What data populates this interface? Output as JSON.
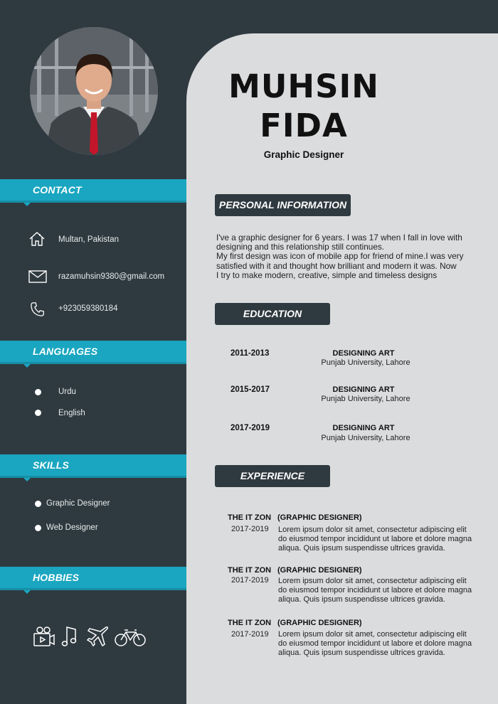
{
  "name": {
    "first": "MUHSIN",
    "last": "FIDA"
  },
  "role": "Graphic Designer",
  "sidebar": {
    "contact": {
      "title": "CONTACT",
      "items": [
        {
          "icon": "home-icon",
          "text": "Multan, Pakistan"
        },
        {
          "icon": "mail-icon",
          "text": "razamuhsin9380@gmail.com"
        },
        {
          "icon": "phone-icon",
          "text": "+923059380184"
        }
      ]
    },
    "languages": {
      "title": "LANGUAGES",
      "items": [
        "Urdu",
        "English"
      ]
    },
    "skills": {
      "title": "SKILLS",
      "items": [
        "Graphic Designer",
        "Web Designer"
      ]
    },
    "hobbies": {
      "title": "HOBBIES",
      "icons": [
        "video-camera-icon",
        "music-note-icon",
        "airplane-icon",
        "bicycle-icon"
      ]
    }
  },
  "personal_info": {
    "title": "PERSONAL INFORMATION",
    "lines": [
      "I've a graphic designer for 6 years. I was 17 when I fall in love with",
      "designing and this relationship still continues.",
      "My first design was icon of mobile app for friend of mine.I was very",
      "satisfied with it and thought how brilliant and modern it was. Now",
      "I try to make modern, creative, simple and timeless designs"
    ]
  },
  "education": {
    "title": "EDUCATION",
    "entries": [
      {
        "years": "2011-2013",
        "title": "DESIGNING ART",
        "place": "Punjab University, Lahore"
      },
      {
        "years": "2015-2017",
        "title": "DESIGNING ART",
        "place": "Punjab University, Lahore"
      },
      {
        "years": "2017-2019",
        "title": "DESIGNING ART",
        "place": "Punjab University, Lahore"
      }
    ]
  },
  "experience": {
    "title": "EXPERIENCE",
    "entries": [
      {
        "company": "THE IT ZON",
        "role": "(GRAPHIC DESIGNER)",
        "years": "2017-2019",
        "lines": [
          "Lorem ipsum dolor sit amet, consectetur adipiscing elit",
          "do eiusmod tempor incididunt ut labore et dolore magna",
          "aliqua. Quis ipsum suspendisse ultrices gravida."
        ]
      },
      {
        "company": "THE IT ZON",
        "role": "(GRAPHIC DESIGNER)",
        "years": "2017-2019",
        "lines": [
          "Lorem ipsum dolor sit amet, consectetur adipiscing elit",
          "do eiusmod tempor incididunt ut labore et dolore magna",
          "aliqua. Quis ipsum suspendisse ultrices gravida."
        ]
      },
      {
        "company": "THE IT ZON",
        "role": "(GRAPHIC DESIGNER)",
        "years": "2017-2019",
        "lines": [
          "Lorem ipsum dolor sit amet, consectetur adipiscing elit",
          "do eiusmod tempor incididunt ut labore et dolore magna",
          "aliqua. Quis ipsum suspendisse ultrices gravida."
        ]
      }
    ]
  },
  "colors": {
    "sidebar": "#2f3a40",
    "accent": "#1aa6c0",
    "main_bg": "#dbdcde",
    "pill": "#2f3a40"
  }
}
